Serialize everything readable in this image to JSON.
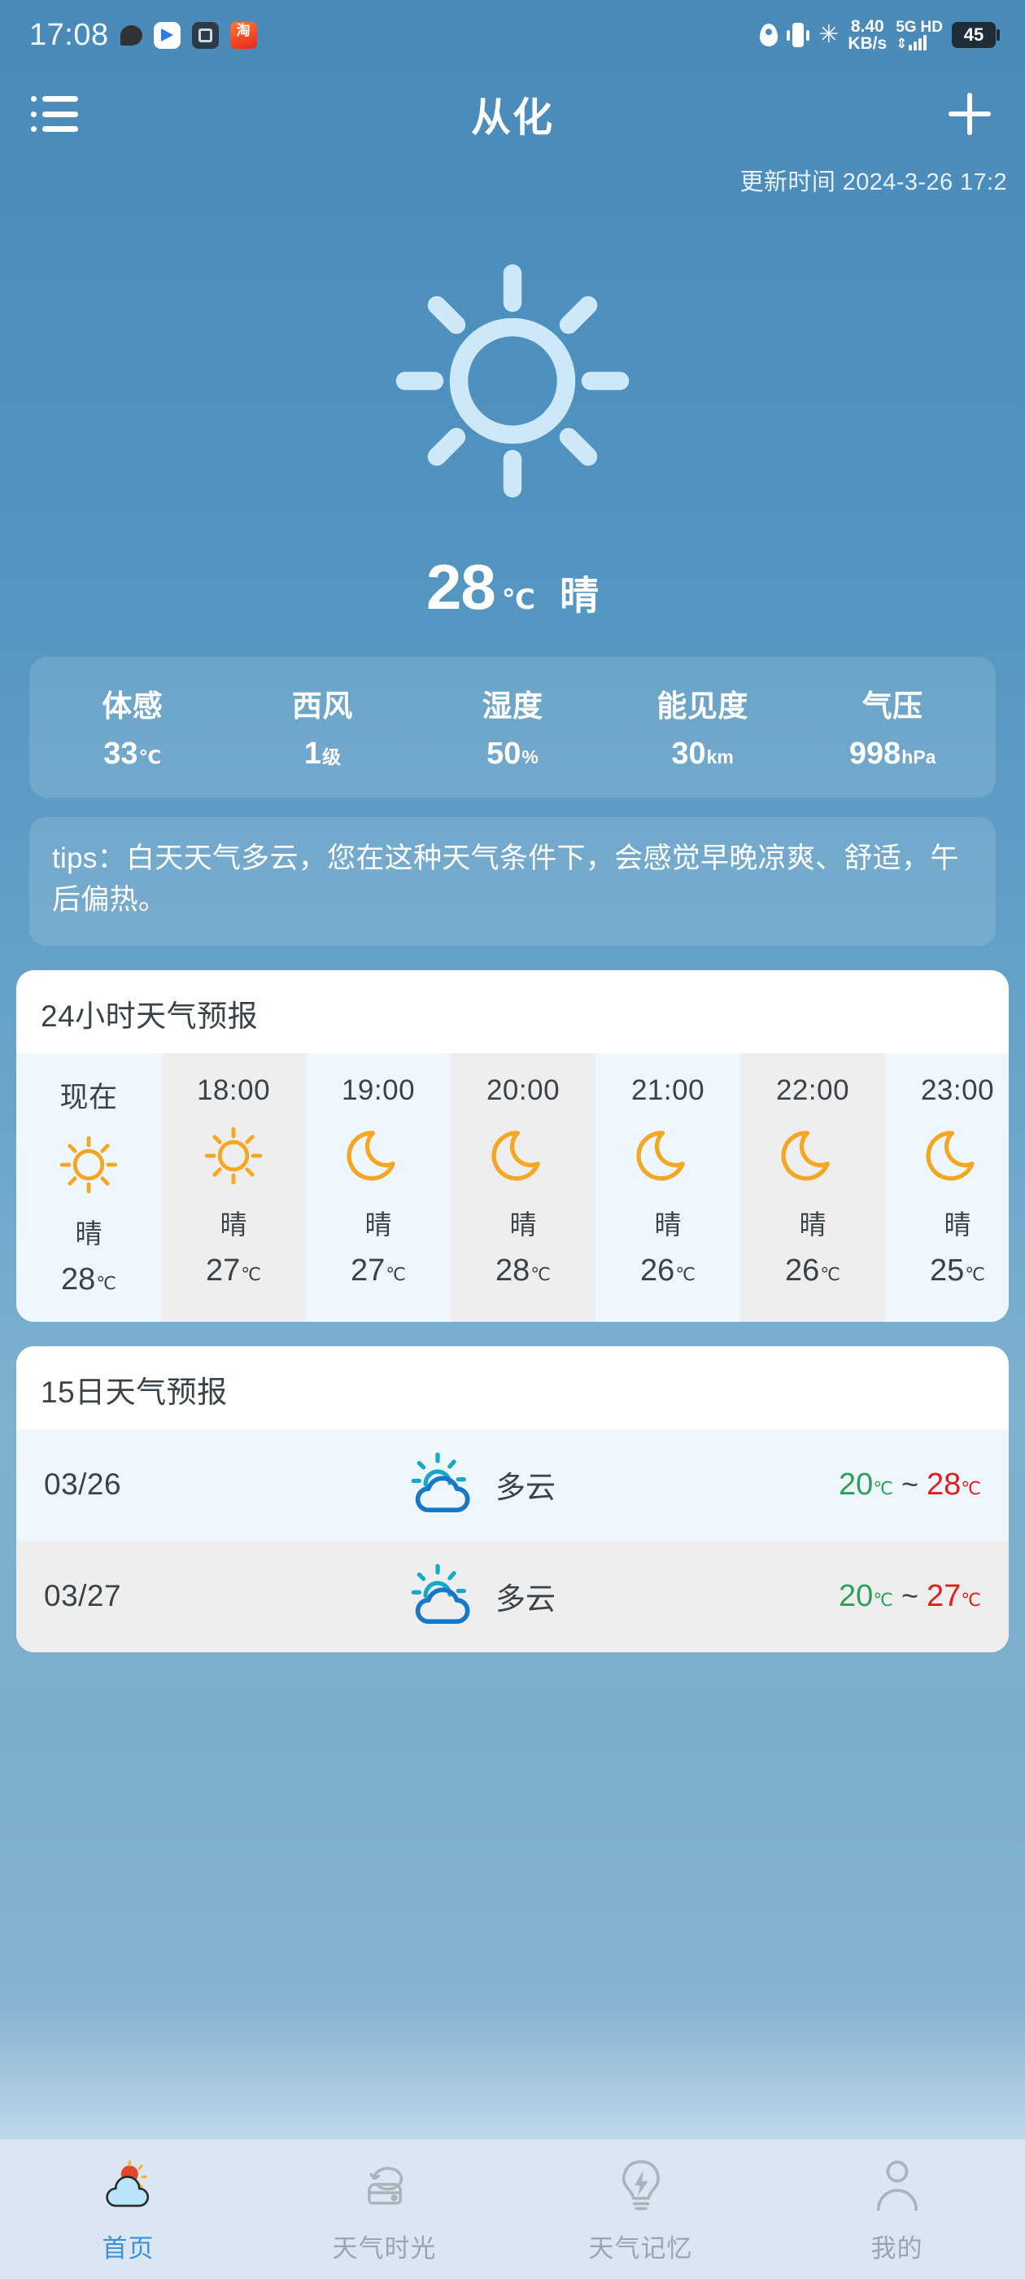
{
  "status_bar": {
    "time": "17:08",
    "app_icons": [
      "chat-bubble-icon",
      "baidu-icon",
      "note-icon",
      "taobao-icon"
    ],
    "taobao_glyph": "淘",
    "location_icon": "location-pin-icon",
    "vibrate_icon": "vibrate-icon",
    "bluetooth_icon": "bluetooth-icon",
    "bluetooth_glyph": "✳",
    "net_speed_value": "8.40",
    "net_speed_unit": "KB/s",
    "network_type": "5G",
    "hd_label": "HD",
    "battery": "45"
  },
  "header": {
    "menu_icon": "list-menu-icon",
    "title": "从化",
    "add_icon": "plus-icon"
  },
  "update": {
    "text": "更新时间 2024-3-26 17:2"
  },
  "current": {
    "weather_icon": "sun-icon",
    "temperature": "28",
    "unit": "℃",
    "condition": "晴"
  },
  "metrics": [
    {
      "label": "体感",
      "value": "33",
      "unit": "℃"
    },
    {
      "label": "西风",
      "value": "1",
      "unit": "级"
    },
    {
      "label": "湿度",
      "value": "50",
      "unit": "%"
    },
    {
      "label": "能见度",
      "value": "30",
      "unit": "km"
    },
    {
      "label": "气压",
      "value": "998",
      "unit": "hPa"
    }
  ],
  "tips": {
    "text": "tips：白天天气多云，您在这种天气条件下，会感觉早晚凉爽、舒适，午后偏热。"
  },
  "hourly": {
    "title": "24小时天气预报",
    "items": [
      {
        "time": "现在",
        "icon": "sun-icon",
        "desc": "晴",
        "temp": "28",
        "unit": "℃"
      },
      {
        "time": "18:00",
        "icon": "sun-icon",
        "desc": "晴",
        "temp": "27",
        "unit": "℃"
      },
      {
        "time": "19:00",
        "icon": "moon-icon",
        "desc": "晴",
        "temp": "27",
        "unit": "℃"
      },
      {
        "time": "20:00",
        "icon": "moon-icon",
        "desc": "晴",
        "temp": "28",
        "unit": "℃"
      },
      {
        "time": "21:00",
        "icon": "moon-icon",
        "desc": "晴",
        "temp": "26",
        "unit": "℃"
      },
      {
        "time": "22:00",
        "icon": "moon-icon",
        "desc": "晴",
        "temp": "26",
        "unit": "℃"
      },
      {
        "time": "23:00",
        "icon": "moon-icon",
        "desc": "晴",
        "temp": "25",
        "unit": "℃"
      }
    ]
  },
  "daily": {
    "title": "15日天气预报",
    "items": [
      {
        "date": "03/26",
        "icon": "sun-cloud-icon",
        "desc": "多云",
        "low": "20",
        "high": "28",
        "unit": "℃",
        "separator": "~"
      },
      {
        "date": "03/27",
        "icon": "sun-cloud-icon",
        "desc": "多云",
        "low": "20",
        "high": "27",
        "unit": "℃",
        "separator": "~"
      }
    ]
  },
  "nav": [
    {
      "label": "首页",
      "icon": "home-weather-icon",
      "active": true
    },
    {
      "label": "天气时光",
      "icon": "weather-time-icon",
      "active": false
    },
    {
      "label": "天气记忆",
      "icon": "lightbulb-icon",
      "active": false
    },
    {
      "label": "我的",
      "icon": "person-icon",
      "active": false
    }
  ],
  "colors": {
    "background_top": "#4a8ab8",
    "accent_active": "#3e8fd8",
    "temp_low": "#2aa05a",
    "temp_high": "#e31c1c",
    "hour_icon_orange": "#f5a623",
    "day_icon_blue": "#1878c8"
  }
}
